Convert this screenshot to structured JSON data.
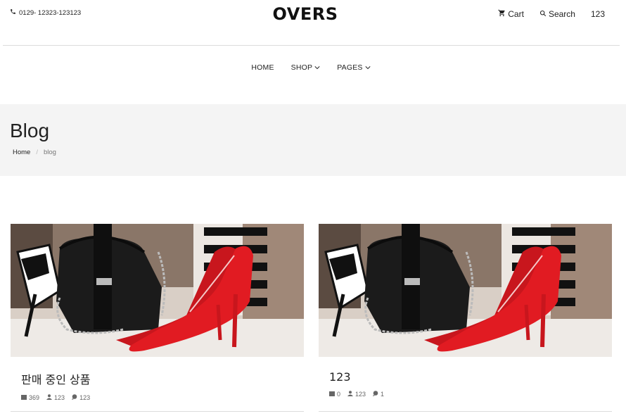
{
  "header": {
    "phone": "0129- 12323-123123",
    "logo": "OVERS",
    "cart_label": "Cart",
    "search_label": "Search",
    "user_label": "123"
  },
  "nav": {
    "items": [
      {
        "label": "HOME",
        "dropdown": false
      },
      {
        "label": "SHOP",
        "dropdown": true
      },
      {
        "label": "PAGES",
        "dropdown": true
      }
    ]
  },
  "hero": {
    "title": "Blog",
    "breadcrumb": {
      "home": "Home",
      "separator": "/",
      "current": "blog"
    }
  },
  "posts": [
    {
      "title": "판매 중인 상품",
      "views": "369",
      "author": "123",
      "comments": "123",
      "image": "red-high-heels-and-black-handbag"
    },
    {
      "title": "123",
      "views": "0",
      "author": "123",
      "comments": "1",
      "image": "red-high-heels-and-black-handbag"
    }
  ],
  "colors": {
    "hero_bg": "#f4f4f4",
    "shoe_red": "#c8161d",
    "text": "#222222"
  }
}
